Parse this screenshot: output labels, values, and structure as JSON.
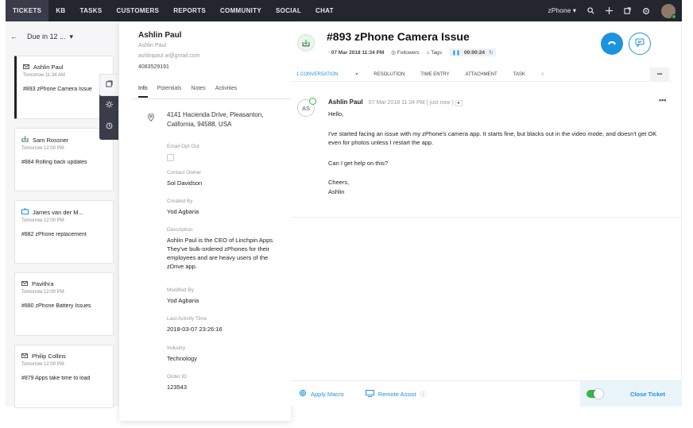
{
  "nav": {
    "tabs": [
      "TICKETS",
      "KB",
      "TASKS",
      "CUSTOMERS",
      "REPORTS",
      "COMMUNITY",
      "SOCIAL",
      "CHAT"
    ],
    "active": "TICKETS",
    "department": "zPhone",
    "dept_caret": "▾"
  },
  "list": {
    "back": "←",
    "filter": "Due in 12 ...",
    "caret": "▾",
    "tickets": [
      {
        "name": "Ashlin Paul",
        "time": "Tomorrow 11:34 AM",
        "subject": "#893  zPhone Camera Issue"
      },
      {
        "name": "Sam Rossner",
        "time": "Tomorrow 12:00 PM",
        "subject": "#884  Rolling back updates"
      },
      {
        "name": "James van der M...",
        "time": "Tomorrow 12:00 PM",
        "subject": "#882  zPhone replacement"
      },
      {
        "name": "Pavithra",
        "time": "Tomorrow 12:00 PM",
        "subject": "#880  zPhone Battery Issues"
      },
      {
        "name": "Philip Collins",
        "time": "Tomorrow 12:00 PM",
        "subject": "#879  Apps take time to load"
      }
    ]
  },
  "contact": {
    "name": "Ashlin Paul",
    "subname": "Ashlin Paul",
    "email": "ashlinpaul.w@gmail.com",
    "phone": "4083529191",
    "tabs": [
      "Info",
      "Potentials",
      "Notes",
      "Activities"
    ],
    "address": "4141 Hacienda Drive, Pleasanton, California, 94588, USA",
    "email_opt_out_label": "Email Opt Out",
    "owner_label": "Contact Owner",
    "owner": "Sol Davidson",
    "created_label": "Created By",
    "created": "Yod Agbaria",
    "desc_label": "Description",
    "desc": "Ashlin Paul is the CEO of Linchpin Apps. They've bulk-ordered zPhones for their employees and are heavy users of the zDrive app.",
    "modified_label": "Modified By",
    "modified": "Yod Agbaria",
    "activity_label": "Last Activity Time",
    "activity": "2018-03-07 23:26:16",
    "industry_label": "Industry",
    "industry": "Technology",
    "order_label": "Order ID",
    "order": "123543"
  },
  "ticket": {
    "title": "#893  zPhone Camera Issue",
    "date": "07 Mar 2018 11:34 PM",
    "followers": "Followers",
    "tags": "Tags",
    "timer": "00:00:24",
    "tabs": [
      "1 CONVERSATION",
      "RESOLUTION",
      "TIME ENTRY",
      "ATTACHMENT",
      "TASK"
    ],
    "more": "•••"
  },
  "message": {
    "avatar": "AS",
    "author": "Ashlin Paul",
    "when": "07 Mar 2018 11:34 PM ( just now )",
    "greeting": "Hello,",
    "body": "I've started facing an issue with my zPhone's camera app. It starts fine, but blacks out in the video mode, and doesn't get OK even for photos unless I restart the app.",
    "question": "Can I get help on this?",
    "signoff": "Cheers,",
    "signature": "Ashlin",
    "menu": "•••"
  },
  "actions": {
    "macro": "Apply Macro",
    "remote": "Remote Assist",
    "close": "Close Ticket"
  },
  "colors": {
    "accent": "#1d93e0",
    "nav": "#23252f",
    "success": "#3cb34a"
  }
}
